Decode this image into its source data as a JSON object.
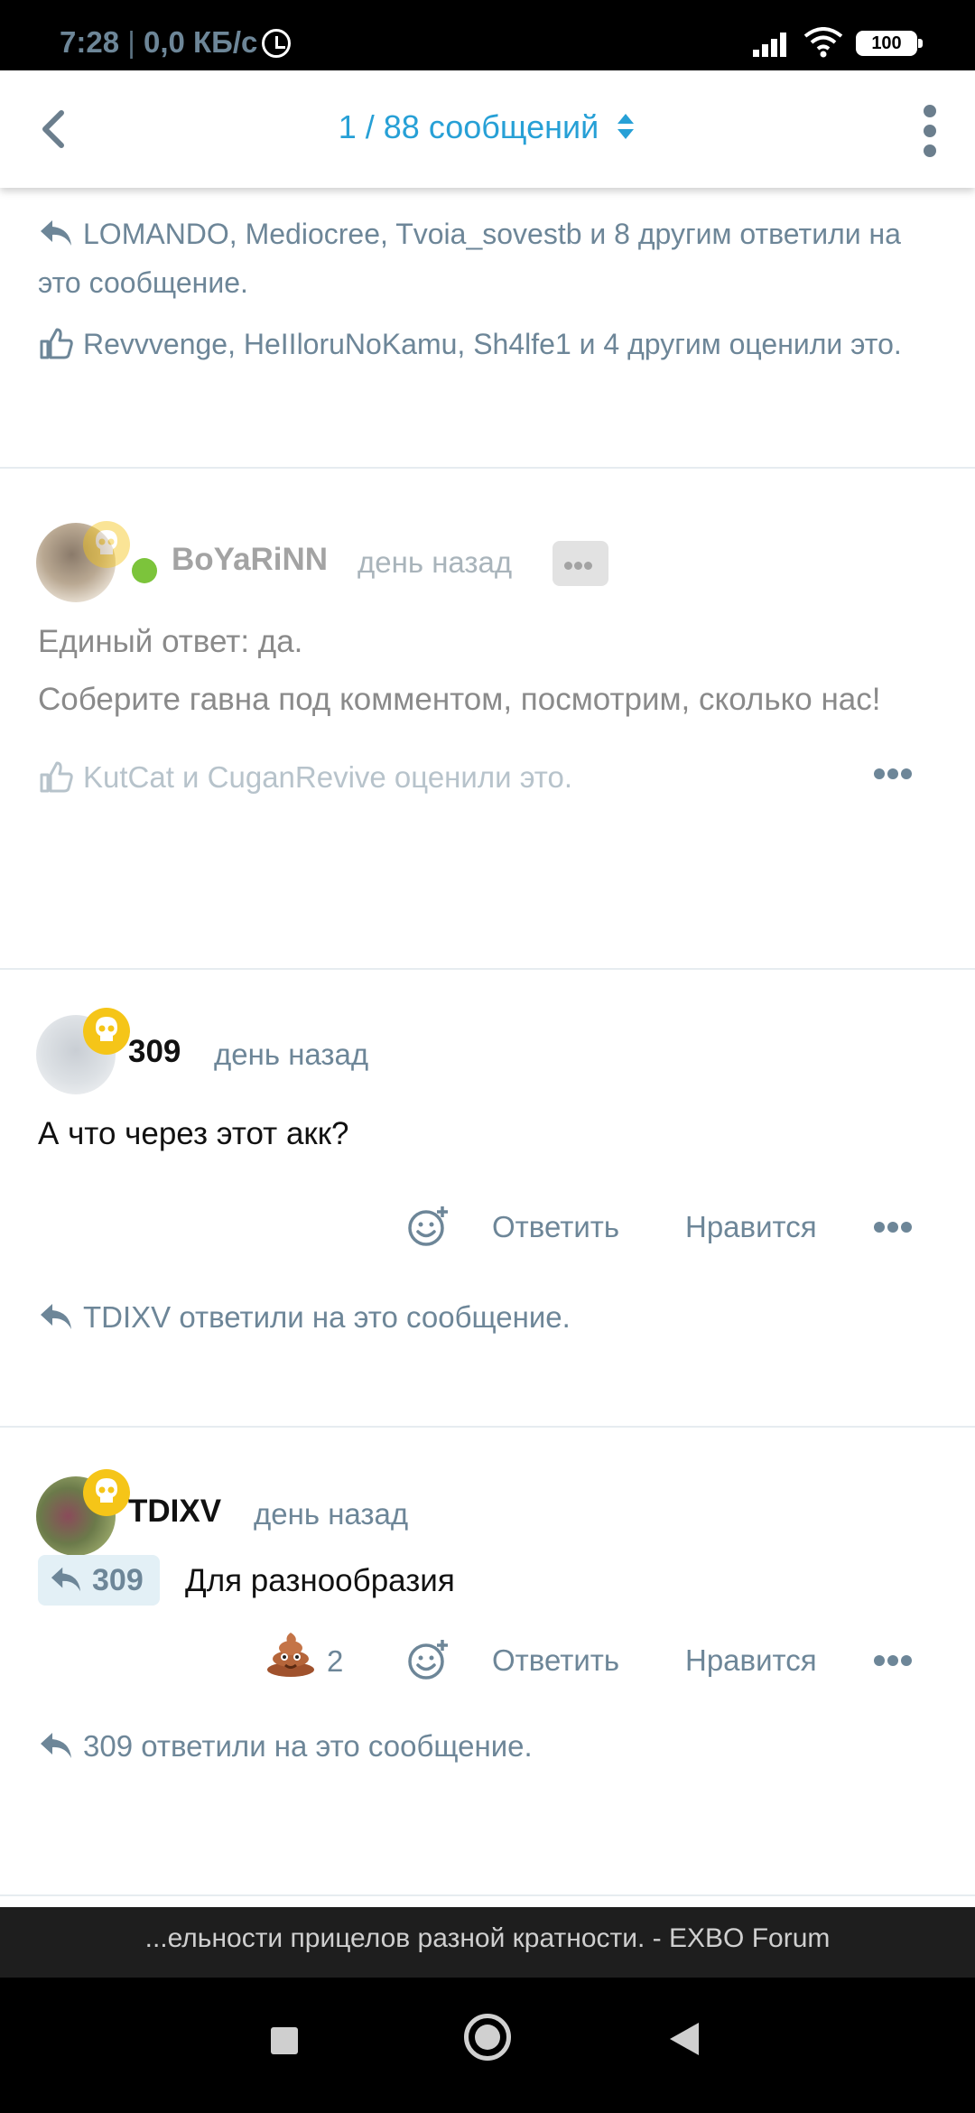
{
  "status_bar": {
    "time": "7:28",
    "separator": "|",
    "net_speed": "0,0 КБ/с",
    "battery": "100"
  },
  "header": {
    "title": "1 / 88 сообщений"
  },
  "top_meta": {
    "replies": "LOMANDO, Mediocree, Tvoia_sovestb и 8 другим ответили на это сообщение.",
    "likes": "Revvvenge, HeIIloruNoKamu, Sh4lfe1 и 4 другим оценили это."
  },
  "posts": [
    {
      "author": "BoYaRiNN",
      "time": "день назад",
      "lines": [
        "Единый ответ: да.",
        "Соберите гавна под комментом, посмотрим, сколько нас!"
      ],
      "likes": "KutCat и CuganRevive оценили это."
    },
    {
      "author": "309",
      "time": "день назад",
      "text": "А что через этот акк?",
      "reply_label": "Ответить",
      "like_label": "Нравится",
      "replies": "TDIXV ответили на это сообщение."
    },
    {
      "author": "TDIXV",
      "time": "день назад",
      "quote": "309",
      "text": "Для разнообразия",
      "reaction_count": "2",
      "reply_label": "Ответить",
      "like_label": "Нравится",
      "replies": "309 ответили на это сообщение."
    }
  ],
  "browser_bar": {
    "title": "...ельности прицелов разной кратности. - EXBO Forum"
  },
  "colors": {
    "accent": "#27a0d6",
    "muted": "#6d8698",
    "online": "#7cc43b",
    "badge": "#f5c518"
  }
}
